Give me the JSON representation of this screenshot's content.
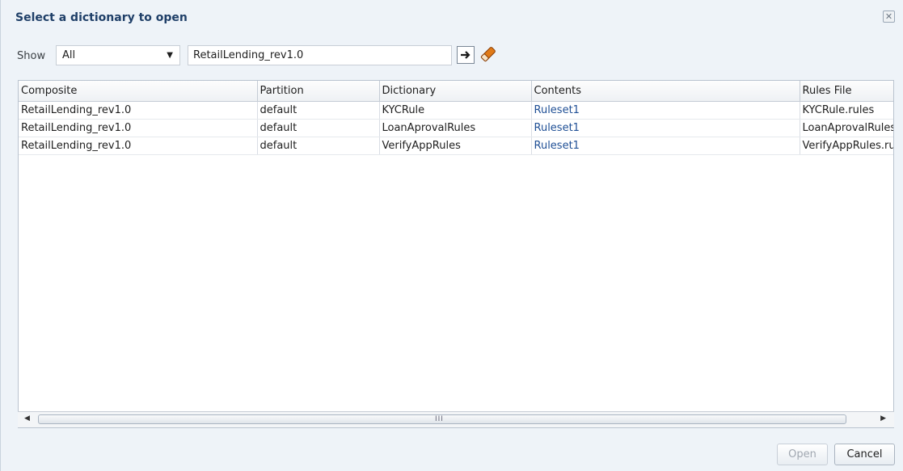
{
  "dialog": {
    "title": "Select a dictionary to open",
    "close_icon": "close-icon"
  },
  "filter": {
    "show_label": "Show",
    "select_value": "All",
    "search_value": "RetailLending_rev1.0",
    "go_icon": "arrow-right-icon",
    "clear_icon": "eraser-icon"
  },
  "table": {
    "columns": [
      "Composite",
      "Partition",
      "Dictionary",
      "Contents",
      "Rules File"
    ],
    "rows": [
      [
        "RetailLending_rev1.0",
        "default",
        "KYCRule",
        "Ruleset1",
        "KYCRule.rules"
      ],
      [
        "RetailLending_rev1.0",
        "default",
        "LoanAprovalRules",
        "Ruleset1",
        "LoanAprovalRules.rules"
      ],
      [
        "RetailLending_rev1.0",
        "default",
        "VerifyAppRules",
        "Ruleset1",
        "VerifyAppRules.rules"
      ]
    ],
    "link_color": "#1f4f95"
  },
  "scrollbar": {
    "grip": "III"
  },
  "buttons": {
    "open_label": "Open",
    "cancel_label": "Cancel"
  }
}
